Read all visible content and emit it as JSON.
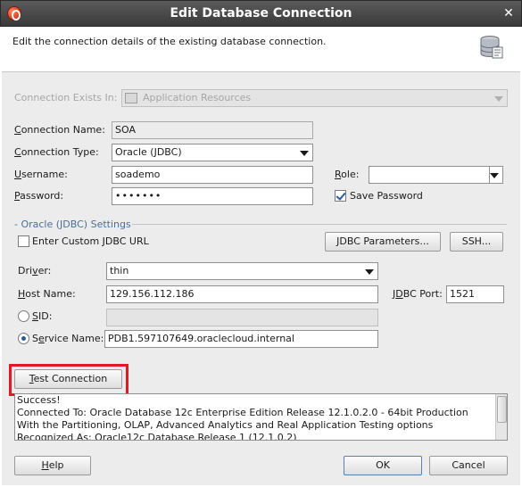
{
  "window": {
    "title": "Edit Database Connection"
  },
  "header": {
    "description": "Edit the connection details of the existing database connection."
  },
  "form": {
    "connection_exists_in": {
      "label": "Connection Exists In:",
      "value": "Application Resources"
    },
    "connection_name": {
      "label": "Connection Name:",
      "value": "SOA"
    },
    "connection_type": {
      "label": "Connection Type:",
      "value": "Oracle (JDBC)"
    },
    "username": {
      "label": "Username:",
      "value": "soademo"
    },
    "password": {
      "label": "Password:",
      "value": "•••••••"
    },
    "role": {
      "label": "Role:",
      "value": ""
    },
    "save_password": {
      "label": "Save Password",
      "checked": true
    }
  },
  "jdbc_settings": {
    "section_title": "- Oracle (JDBC) Settings",
    "custom_url": {
      "label": "Enter Custom JDBC URL",
      "checked": false
    },
    "jdbc_parameters_button": "JDBC Parameters...",
    "ssh_button": "SSH...",
    "driver": {
      "label": "Driver:",
      "value": "thin"
    },
    "host_name": {
      "label": "Host Name:",
      "value": "129.156.112.186"
    },
    "jdbc_port": {
      "label": "JDBC Port:",
      "value": "1521"
    },
    "sid": {
      "label": "SID:",
      "value": "",
      "selected": false
    },
    "service_name": {
      "label": "Service Name:",
      "value": "PDB1.597107649.oraclecloud.internal",
      "selected": true
    }
  },
  "test": {
    "button_label": "Test Connection",
    "log": [
      "Success!",
      "Connected To: Oracle Database 12c Enterprise Edition Release 12.1.0.2.0 - 64bit Production",
      "With the Partitioning, OLAP, Advanced Analytics and Real Application Testing options",
      "Recognized As: Oracle12c Database Release 1 (12.1.0.2)"
    ]
  },
  "footer": {
    "help_label": "Help",
    "ok_label": "OK",
    "cancel_label": "Cancel"
  },
  "colors": {
    "highlight": "#e01a22",
    "section_title": "#4b6f96",
    "titlebar": "#3a3a3a"
  }
}
